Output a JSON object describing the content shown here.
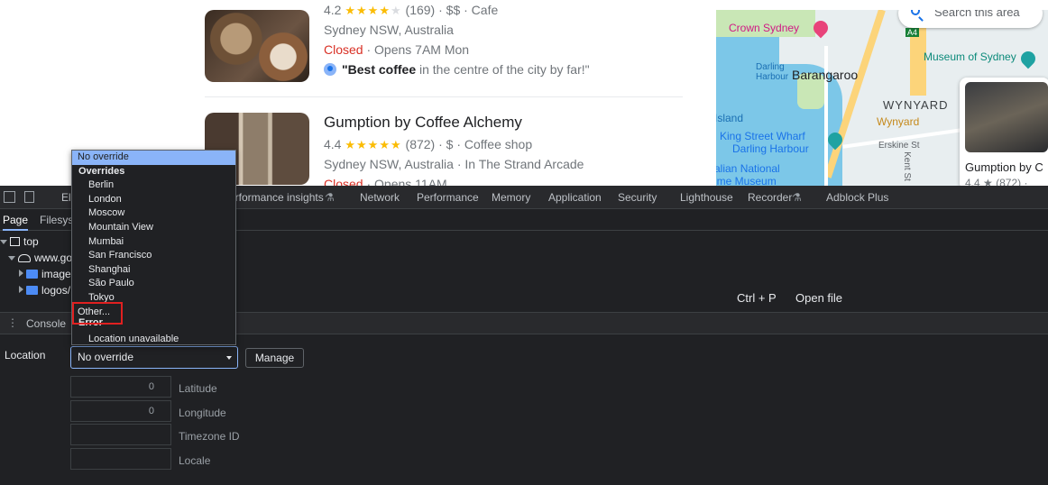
{
  "webpage": {
    "listings": [
      {
        "rating_line": "4.2",
        "stars_filled": "★★★★",
        "stars_empty": "★",
        "rating_rest": " (169) · $$ · Cafe",
        "address": "Sydney NSW, Australia",
        "status": "Closed",
        "status_rest": " · Opens 7AM Mon",
        "review_bold": "\"Best coffee",
        "review_rest": " in the centre of the city by far!\""
      },
      {
        "name": "Gumption by Coffee Alchemy",
        "rating_line": "4.4",
        "stars": "★★★★★",
        "rating_rest": " (872) · $ · Coffee shop",
        "address": "Sydney NSW, Australia · In The Strand Arcade",
        "status": "Closed",
        "status_rest": " · Opens 11AM"
      }
    ],
    "map": {
      "search_placeholder": "Search this area",
      "labels": {
        "crown": "Crown Sydney",
        "museum": "Museum of Sydney",
        "darling_harbour": "Darling\nHarbour",
        "barangaroo": "Barangaroo",
        "wynyard_caps": "WYNYARD",
        "wynyard": "Wynyard",
        "island": "Island",
        "king_street": "King Street Wharf",
        "darling_harbour2": "Darling Harbour",
        "national": "alian National",
        "museum2": "ime Museum",
        "erskine": "Erskine St",
        "kent": "Kent St",
        "a4": "A4"
      },
      "card": {
        "name": "Gumption by C",
        "rating": "4.4 ★ (872) ·"
      }
    }
  },
  "devtools": {
    "tabs": [
      "Ele",
      "erformance insights",
      "Network",
      "Performance",
      "Memory",
      "Application",
      "Security",
      "Lighthouse",
      "Recorder",
      "Adblock Plus"
    ],
    "sources": {
      "subtabs": [
        "Page",
        "Filesyst"
      ],
      "tree": [
        "top",
        "www.go",
        "image",
        "logos/"
      ],
      "shortcut_key": "Ctrl + P",
      "shortcut_action": "Open file"
    },
    "drawer": {
      "kebab": "⋮",
      "console_tab": "Console"
    },
    "sensors": {
      "location_label": "Location",
      "location_value": "No override",
      "manage_label": "Manage",
      "latitude_value": "0",
      "latitude_label": "Latitude",
      "longitude_value": "0",
      "longitude_label": "Longitude",
      "timezone_label": "Timezone ID",
      "locale_label": "Locale"
    },
    "dropdown": {
      "selected": "No override",
      "overrides_group": "Overrides",
      "cities": [
        "Berlin",
        "London",
        "Moscow",
        "Mountain View",
        "Mumbai",
        "San Francisco",
        "Shanghai",
        "São Paulo",
        "Tokyo"
      ],
      "other": "Other...",
      "error_group": "Error",
      "location_unavailable": "Location unavailable"
    }
  },
  "colors": {
    "devtools_bg": "#202124",
    "accent": "#8ab4f8",
    "highlight_box": "#e02020",
    "closed_red": "#d93025",
    "star_yellow": "#fbbc04"
  }
}
